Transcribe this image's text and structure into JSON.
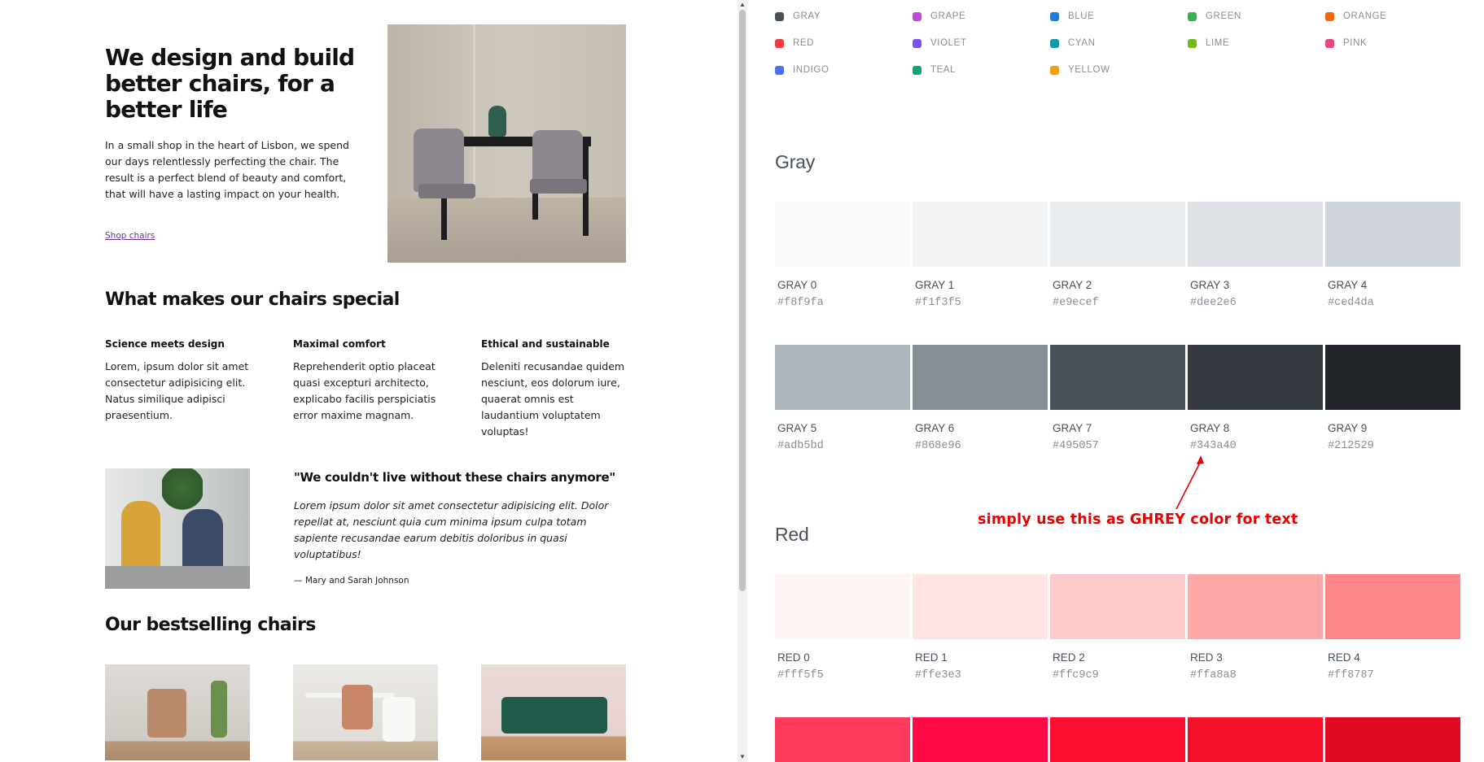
{
  "left": {
    "hero": {
      "title": "We design and build better chairs, for a better life",
      "text": "In a small shop in the heart of Lisbon, we spend our days relentlessly perfecting the chair. The result is a perfect blend of beauty and comfort, that will have a lasting impact on your health.",
      "link": "Shop chairs"
    },
    "features_title": "What makes our chairs special",
    "features": [
      {
        "title": "Science meets design",
        "text": "Lorem, ipsum dolor sit amet consectetur adipisicing elit. Natus similique adipisci praesentium."
      },
      {
        "title": "Maximal comfort",
        "text": "Reprehenderit optio placeat quasi excepturi architecto, explicabo facilis perspiciatis error maxime magnam."
      },
      {
        "title": "Ethical and sustainable",
        "text": "Deleniti recusandae quidem nesciunt, eos dolorum iure, quaerat omnis est laudantium voluptatem voluptas!"
      }
    ],
    "testimonial": {
      "title": "\"We couldn't live without these chairs anymore\"",
      "text": "Lorem ipsum dolor sit amet consectetur adipisicing elit. Dolor repellat at, nesciunt quia cum minima ipsum culpa totam sapiente recusandae earum debitis doloribus in quasi voluptatibus!",
      "author": "— Mary and Sarah Johnson"
    },
    "bestsellers_title": "Our bestselling chairs"
  },
  "scrollbar": {
    "up_icon": "▲",
    "down_icon": "▼"
  },
  "right": {
    "legend": [
      {
        "label": "GRAY",
        "color": "#495057"
      },
      {
        "label": "GRAPE",
        "color": "#be4bdb"
      },
      {
        "label": "BLUE",
        "color": "#1c7ed6"
      },
      {
        "label": "GREEN",
        "color": "#37b24d"
      },
      {
        "label": "ORANGE",
        "color": "#f76707"
      },
      {
        "label": "RED",
        "color": "#f03e3e"
      },
      {
        "label": "VIOLET",
        "color": "#7950f2"
      },
      {
        "label": "CYAN",
        "color": "#1098ad"
      },
      {
        "label": "LIME",
        "color": "#74b816"
      },
      {
        "label": "PINK",
        "color": "#e64980"
      },
      {
        "label": "INDIGO",
        "color": "#4c6ef5"
      },
      {
        "label": "TEAL",
        "color": "#0ca678"
      },
      {
        "label": "YELLOW",
        "color": "#f59f00"
      }
    ],
    "gray": {
      "title": "Gray",
      "swatches": [
        {
          "name": "GRAY 0",
          "hex": "#f8f9fa"
        },
        {
          "name": "GRAY 1",
          "hex": "#f1f3f5"
        },
        {
          "name": "GRAY 2",
          "hex": "#e9ecef"
        },
        {
          "name": "GRAY 3",
          "hex": "#dee2e6"
        },
        {
          "name": "GRAY 4",
          "hex": "#ced4da"
        },
        {
          "name": "GRAY 5",
          "hex": "#adb5bd"
        },
        {
          "name": "GRAY 6",
          "hex": "#868e96"
        },
        {
          "name": "GRAY 7",
          "hex": "#495057"
        },
        {
          "name": "GRAY 8",
          "hex": "#343a40"
        },
        {
          "name": "GRAY 9",
          "hex": "#212529"
        }
      ]
    },
    "red": {
      "title": "Red",
      "swatches": [
        {
          "name": "RED 0",
          "hex": "#fff5f5"
        },
        {
          "name": "RED 1",
          "hex": "#ffe3e3"
        },
        {
          "name": "RED 2",
          "hex": "#ffc9c9"
        },
        {
          "name": "RED 3",
          "hex": "#ffa8a8"
        },
        {
          "name": "RED 4",
          "hex": "#ff8787"
        }
      ],
      "partial_colors": [
        "#ff3b5c",
        "#ff0a46",
        "#fa0f30",
        "#f5112a",
        "#e00a22"
      ]
    },
    "annotation": "simply use this as GHREY color for text"
  }
}
